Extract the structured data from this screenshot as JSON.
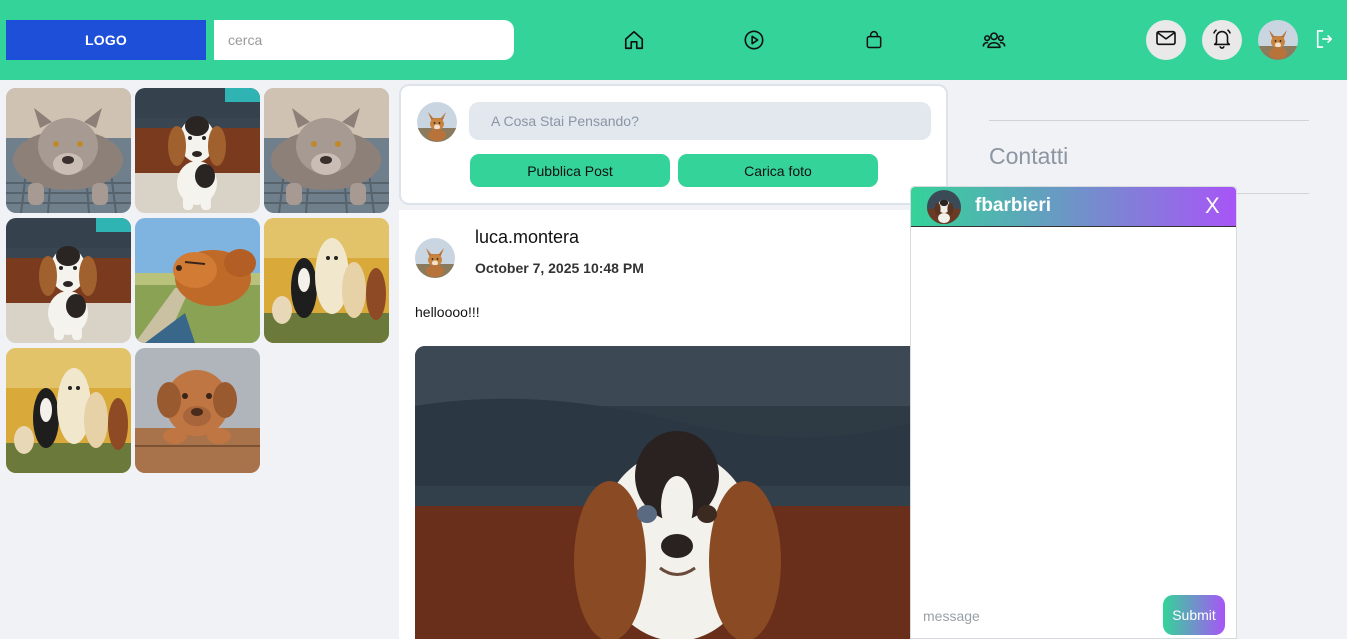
{
  "header": {
    "logo": "LOGO",
    "search_placeholder": "cerca",
    "nav_icons": [
      "home-icon",
      "play-icon",
      "shopping-bag-icon",
      "groups-icon"
    ],
    "action_icons": [
      "mail-icon",
      "bell-icon"
    ],
    "logout_icon": "logout-icon"
  },
  "gallery": {
    "images": [
      "bully-dog",
      "beagle-puppy",
      "bully-dog",
      "beagle-puppy",
      "retriever-in-car",
      "dog-group",
      "dog-group",
      "mastiff-puppy"
    ]
  },
  "composer": {
    "placeholder": "A Cosa Stai Pensando?",
    "publish_label": "Pubblica Post",
    "upload_label": "Carica foto"
  },
  "post": {
    "username": "luca.montera",
    "date": "October 7, 2025 10:48 PM",
    "text": "helloooo!!!"
  },
  "contacts": {
    "title": "Contatti"
  },
  "chat": {
    "username": "fbarbieri",
    "close_label": "X",
    "input_placeholder": "message",
    "submit_label": "Submit"
  },
  "colors": {
    "header_bg": "#34d399",
    "logo_bg": "#1e4fd8",
    "accent_purple": "#a855f7",
    "page_bg": "#f0f2f5"
  }
}
